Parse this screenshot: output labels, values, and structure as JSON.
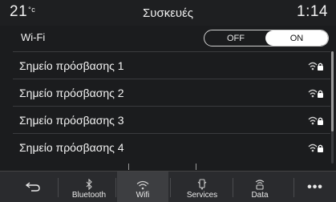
{
  "header": {
    "temperature": "21",
    "temperature_unit": "°c",
    "title": "Συσκευές",
    "clock": "1:14"
  },
  "wifi": {
    "label": "Wi-Fi",
    "toggle_off": "OFF",
    "toggle_on": "ON",
    "state": "ON"
  },
  "networks": [
    {
      "label": "Σημείο πρόσβασης 1",
      "icon": "wifi-lock-icon"
    },
    {
      "label": "Σημείο πρόσβασης 2",
      "icon": "wifi-lock-icon"
    },
    {
      "label": "Σημείο πρόσβασης 3",
      "icon": "wifi-lock-icon"
    },
    {
      "label": "Σημείο πρόσβασης 4",
      "icon": "wifi-lock-icon"
    }
  ],
  "nav": {
    "back_icon": "back-arrow-icon",
    "items": [
      {
        "label": "Bluetooth",
        "icon": "bluetooth-icon"
      },
      {
        "label": "Wifi",
        "icon": "wifi-icon",
        "active": true
      },
      {
        "label": "Services",
        "icon": "services-icon"
      },
      {
        "label": "Data",
        "icon": "data-icon"
      }
    ],
    "more": "•••"
  },
  "colors": {
    "background": "#1b1c1e",
    "nav_background": "#2a2b2e",
    "active_tab": "#3d3e41",
    "toggle_on": "#ffffff"
  }
}
